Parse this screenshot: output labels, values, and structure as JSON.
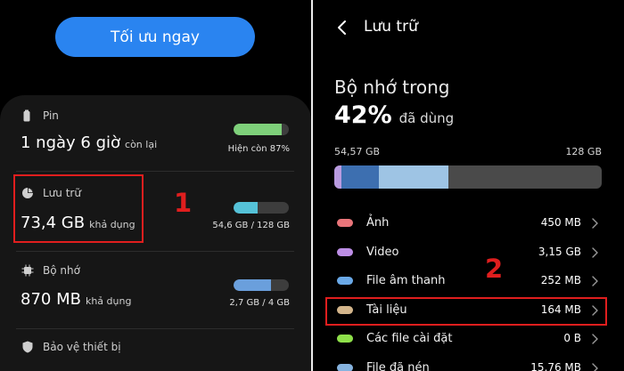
{
  "left": {
    "optimize_button": "Tối ưu ngay",
    "battery": {
      "label": "Pin",
      "value": "1 ngày 6 giờ",
      "suffix": "còn lại",
      "bar_caption": "Hiện còn 87%",
      "level": 0.87,
      "color": "#7ed07a"
    },
    "storage": {
      "label": "Lưu trữ",
      "value": "73,4 GB",
      "suffix": "khả dụng",
      "bar_caption": "54,6 GB / 128 GB",
      "level": 0.43,
      "color": "#55c2d8"
    },
    "memory": {
      "label": "Bộ nhớ",
      "value": "870 MB",
      "suffix": "khả dụng",
      "bar_caption": "2,7 GB / 4 GB",
      "level": 0.68,
      "color": "#6a9fdc"
    },
    "device_protection": {
      "label": "Bảo vệ thiết bị"
    },
    "annotation_number": "1"
  },
  "right": {
    "title": "Lưu trữ",
    "section_title": "Bộ nhớ trong",
    "percent": "42%",
    "percent_suffix": "đã dùng",
    "used_amount": "54,57 GB",
    "total_amount": "128 GB",
    "bar_segments": [
      {
        "share": 0.025,
        "color": "#b99be0"
      },
      {
        "share": 0.14,
        "color": "#3d6fb0"
      },
      {
        "share": 0.26,
        "color": "#9ec4e4"
      }
    ],
    "bar_remainder_color": "#4a4a4a",
    "categories": [
      {
        "name": "Ảnh",
        "size": "450 MB",
        "color": "#e9757a"
      },
      {
        "name": "Video",
        "size": "3,15 GB",
        "color": "#bd8ee6"
      },
      {
        "name": "File âm thanh",
        "size": "252 MB",
        "color": "#6aa9e8"
      },
      {
        "name": "Tài liệu",
        "size": "164 MB",
        "color": "#d3b58b"
      },
      {
        "name": "Các file cài đặt",
        "size": "0 B",
        "color": "#8ee04a"
      },
      {
        "name": "File đã nén",
        "size": "15,76 MB",
        "color": "#86b3df"
      }
    ],
    "annotation_number": "2"
  },
  "colors": {
    "accent": "#2a84f0",
    "annotation": "#e01e1e"
  },
  "icons": {
    "battery": "battery-icon",
    "storage": "pie-chart-icon",
    "memory": "memory-chip-icon",
    "protection": "shield-icon",
    "back": "back-chevron-icon",
    "chevron": "chevron-right-icon"
  }
}
